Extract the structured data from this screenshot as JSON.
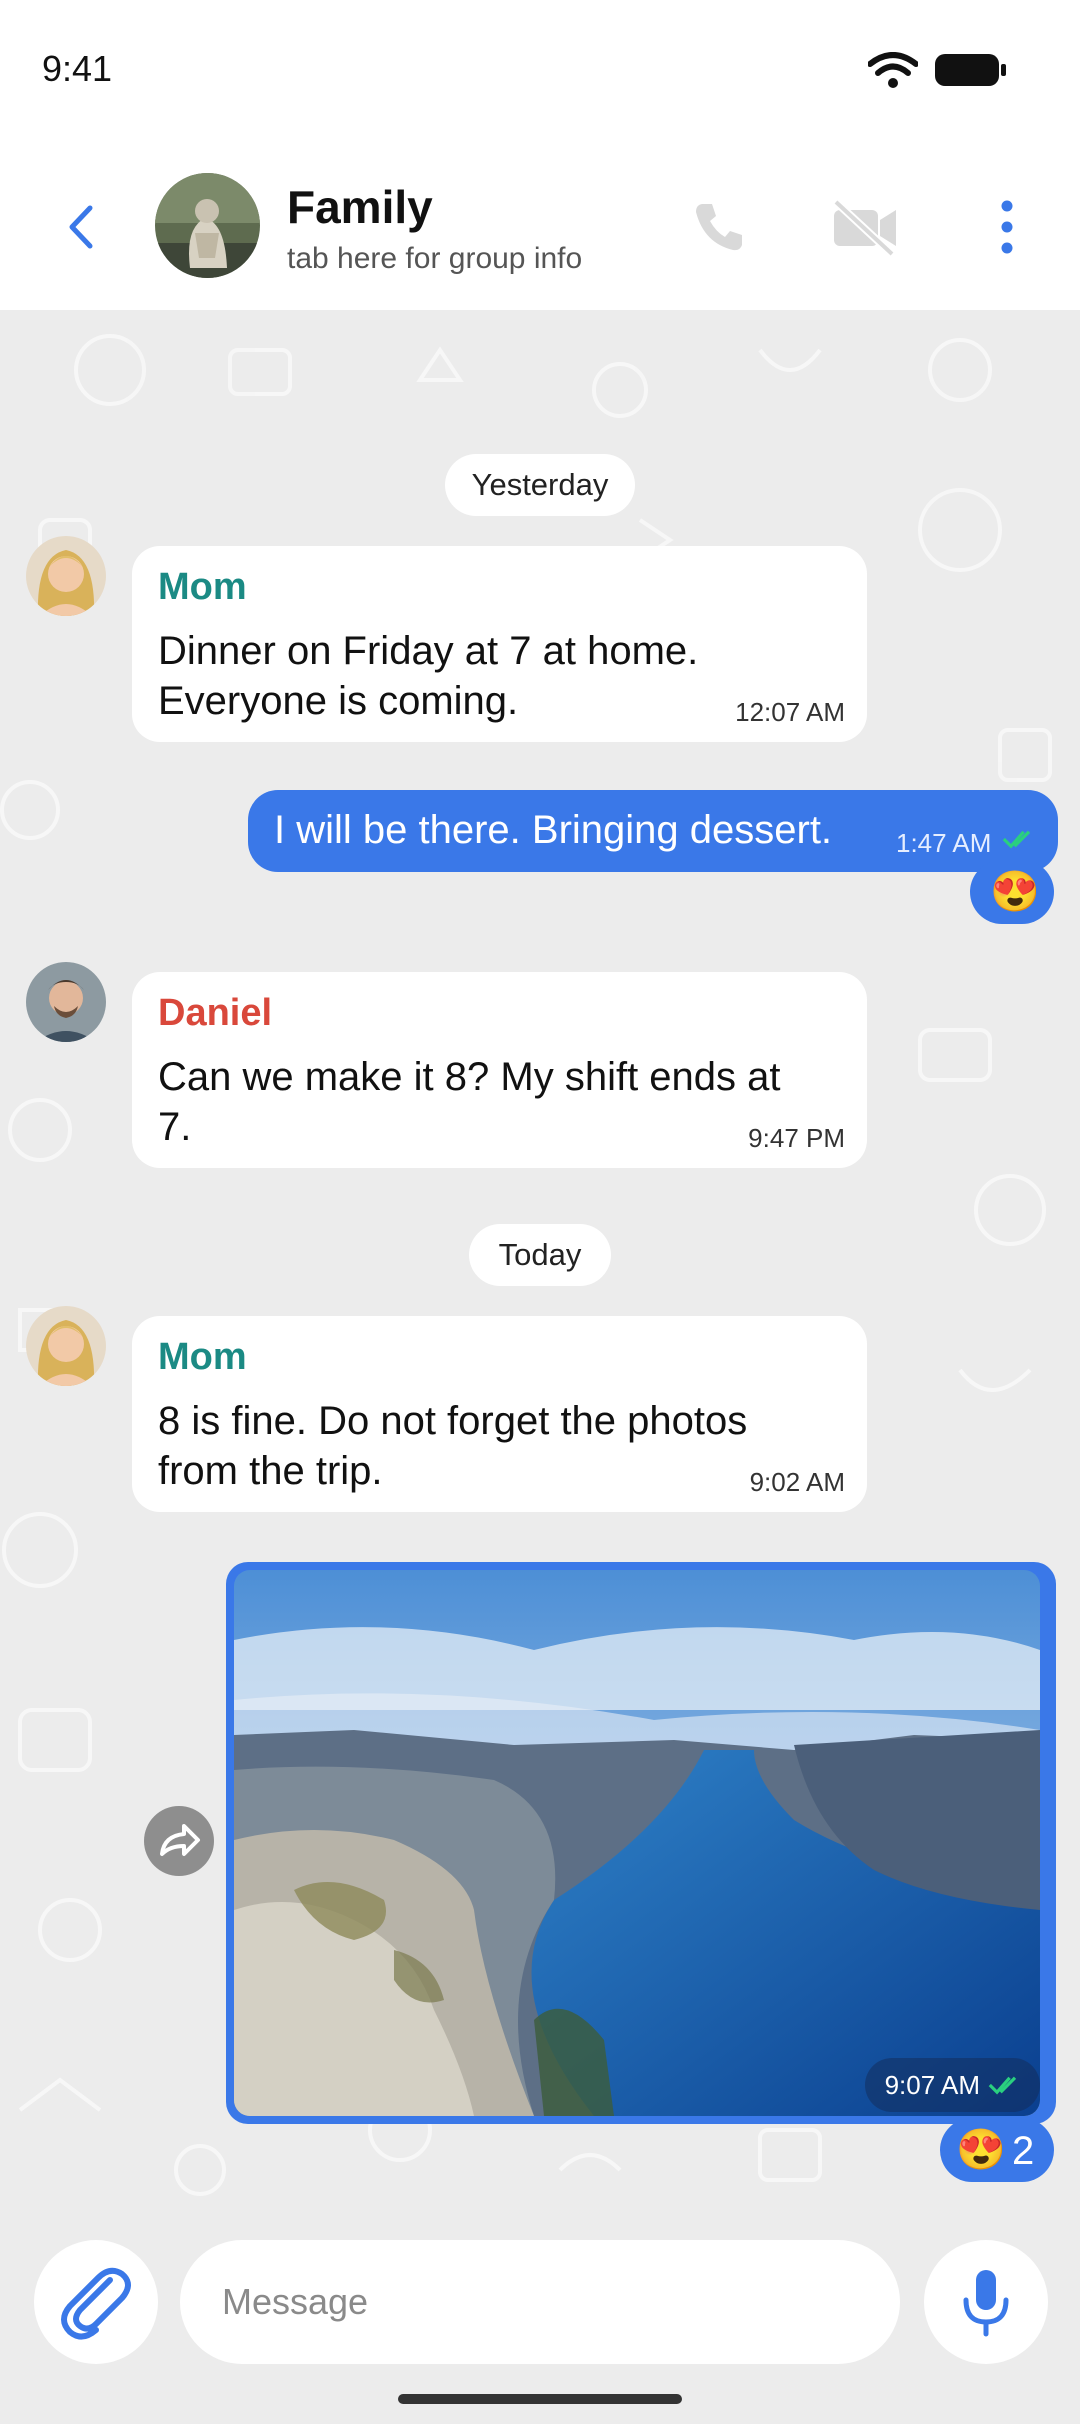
{
  "status_bar": {
    "time": "9:41"
  },
  "header": {
    "title": "Family",
    "subtitle": "tab here for group info"
  },
  "colors": {
    "accent": "#3a78e8",
    "mom_name": "#1b8a84",
    "daniel_name": "#d9483b",
    "chat_bg": "#ececec"
  },
  "chat": {
    "date_yesterday": "Yesterday",
    "date_today": "Today",
    "messages": [
      {
        "sender": "Mom",
        "text": "Dinner on Friday at 7 at home. Everyone is coming.",
        "time": "12:07 AM"
      },
      {
        "sender": "",
        "text": "I will be there. Bringing dessert.",
        "time": "1:47 AM",
        "reaction": "😍"
      },
      {
        "sender": "Daniel",
        "text": "Can we make it 8? My shift ends at 7.",
        "time": "9:47 PM"
      },
      {
        "sender": "Mom",
        "text": "8 is fine. Do not forget the photos from the trip.",
        "time": "9:02 AM"
      },
      {
        "sender": "",
        "type": "photo",
        "time": "9:07 AM",
        "reaction": "😍",
        "reaction_count": "2"
      }
    ]
  },
  "composer": {
    "placeholder": "Message"
  },
  "icons": {
    "back": "chevron-left-icon",
    "call": "phone-icon",
    "video": "video-off-icon",
    "more": "more-vertical-icon",
    "attach": "paperclip-icon",
    "mic": "microphone-icon",
    "forward": "forward-icon",
    "read": "double-check-icon"
  }
}
